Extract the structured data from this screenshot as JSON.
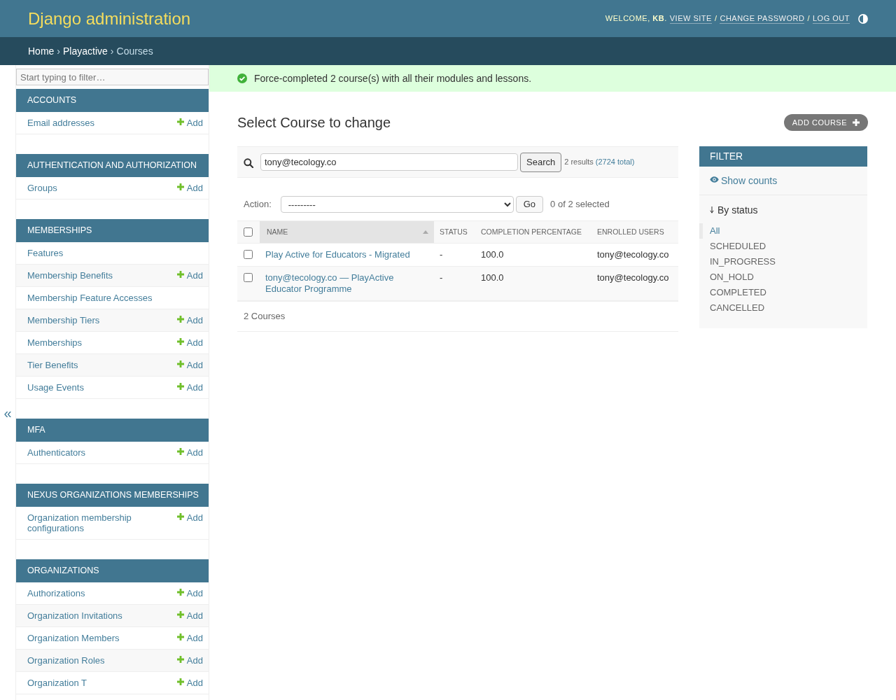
{
  "header": {
    "title": "Django administration",
    "user_tools": [
      {
        "kind": "text",
        "text": "WELCOME, **KB**."
      },
      {
        "kind": "link",
        "text": "VIEW SITE"
      },
      {
        "kind": "separator",
        "text": "/"
      },
      {
        "kind": "link",
        "text": "CHANGE PASSWORD"
      },
      {
        "kind": "separator",
        "text": "/"
      },
      {
        "kind": "link",
        "text": "LOG OUT"
      }
    ]
  },
  "breadcrumbs": [
    {
      "kind": "link",
      "text": "Home"
    },
    {
      "kind": "separator",
      "text": "›"
    },
    {
      "kind": "link",
      "text": "Playactive"
    },
    {
      "kind": "separator",
      "text": "›"
    },
    {
      "kind": "current",
      "text": "Courses"
    }
  ],
  "sidebar": {
    "toggle": "«",
    "filter": {
      "placeholder": "Start typing to filter…"
    },
    "modules": [
      {
        "caption": "ACCOUNTS",
        "items": [
          {
            "label": "Email addresses",
            "add": "Add"
          }
        ]
      },
      {
        "caption": "AUTHENTICATION AND AUTHORIZATION",
        "items": [
          {
            "label": "Groups",
            "add": "Add"
          }
        ]
      },
      {
        "caption": "MEMBERSHIPS",
        "items": [
          {
            "label": "Features"
          },
          {
            "label": "Membership Benefits",
            "add": "Add"
          },
          {
            "label": "Membership Feature Accesses"
          },
          {
            "label": "Membership Tiers",
            "add": "Add"
          },
          {
            "label": "Memberships",
            "add": "Add"
          },
          {
            "label": "Tier Benefits",
            "add": "Add"
          },
          {
            "label": "Usage Events",
            "add": "Add"
          }
        ]
      },
      {
        "caption": "MFA",
        "items": [
          {
            "label": "Authenticators",
            "add": "Add"
          }
        ]
      },
      {
        "caption": "NEXUS ORGANIZATIONS MEMBERSHIPS",
        "items": [
          {
            "label": "Organization membership configurations",
            "add": "Add"
          }
        ]
      },
      {
        "caption": "ORGANIZATIONS",
        "items": [
          {
            "label": "Authorizations",
            "add": "Add"
          },
          {
            "label": "Organization Invitations",
            "add": "Add"
          },
          {
            "label": "Organization Members",
            "add": "Add"
          },
          {
            "label": "Organization Roles",
            "add": "Add"
          },
          {
            "label": "Organization T",
            "add": "Add"
          }
        ]
      }
    ]
  },
  "message": {
    "kind": "success",
    "text": "Force-completed 2 course(s) with all their modules and lessons."
  },
  "content": {
    "title": "Select Course to change",
    "add_button": "ADD COURSE",
    "search": {
      "value": "tony@tecology.co",
      "button": "Search",
      "results": "2 results",
      "total_link": "(2724 total)"
    },
    "actions": {
      "label": "Action:",
      "select_value": "---------",
      "button": "Go",
      "counter": "0 of 2 selected"
    },
    "table": {
      "select_all_checked": false,
      "columns": [
        {
          "label": "NAME",
          "kind": "link",
          "sorted": true
        },
        {
          "label": "STATUS",
          "kind": "text",
          "sorted": false
        },
        {
          "label": "COMPLETION PERCENTAGE",
          "kind": "text",
          "sorted": false
        },
        {
          "label": "ENROLLED USERS",
          "kind": "text",
          "sorted": false
        }
      ],
      "rows": [
        {
          "checked": false,
          "cells": [
            "Play Active for Educators - Migrated",
            "-",
            "100.0",
            "tony@tecology.co"
          ]
        },
        {
          "checked": false,
          "cells": [
            "tony@tecology.co — PlayActive Educator Programme",
            "-",
            "100.0",
            "tony@tecology.co"
          ]
        }
      ]
    },
    "paginator": "2 Courses"
  },
  "filter": {
    "title": "FILTER",
    "show_counts": "Show counts",
    "groups": [
      {
        "title": "By status",
        "expanded": true,
        "choices": [
          {
            "label": "All",
            "selected": true
          },
          {
            "label": "SCHEDULED",
            "selected": false
          },
          {
            "label": "IN_PROGRESS",
            "selected": false
          },
          {
            "label": "ON_HOLD",
            "selected": false
          },
          {
            "label": "COMPLETED",
            "selected": false
          },
          {
            "label": "CANCELLED",
            "selected": false
          }
        ]
      }
    ]
  }
}
